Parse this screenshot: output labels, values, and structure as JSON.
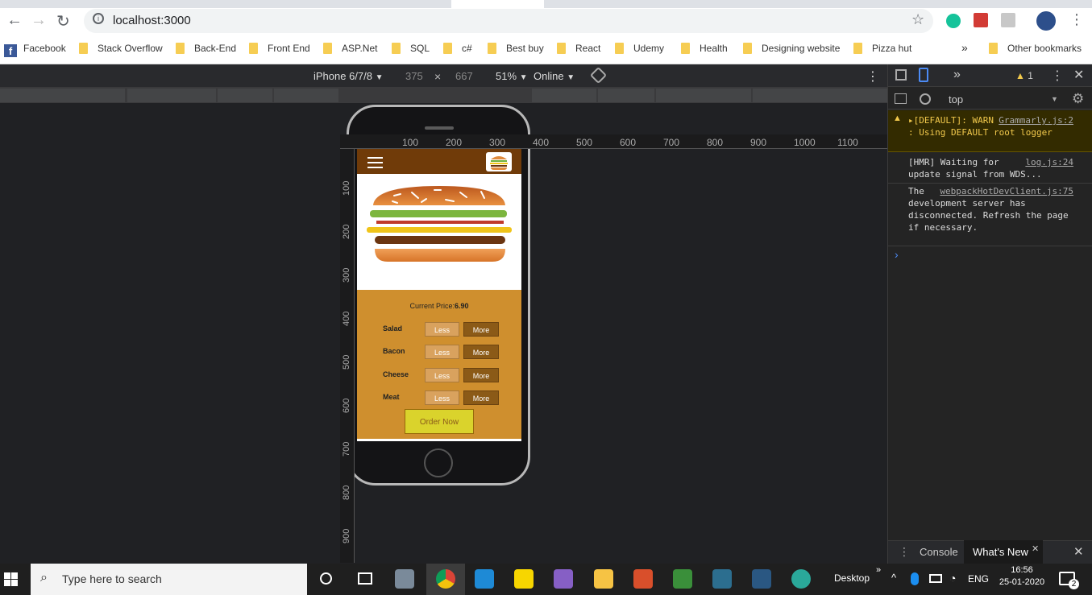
{
  "browser": {
    "url": "localhost:3000",
    "bookmarks": [
      "Facebook",
      "Stack Overflow",
      "Back-End",
      "Front End",
      "ASP.Net",
      "SQL",
      "c#",
      "Best buy",
      "React",
      "Udemy",
      "Health",
      "Designing website",
      "Pizza hut"
    ],
    "more_chevron": "»",
    "other_bookmarks": "Other bookmarks"
  },
  "device_toolbar": {
    "device": "iPhone 6/7/8",
    "width": "375",
    "times": "×",
    "height": "667",
    "zoom": "51%",
    "network": "Online"
  },
  "rulers": {
    "h": [
      "100",
      "200",
      "300",
      "400",
      "500",
      "600",
      "700",
      "800",
      "900",
      "1000",
      "1100"
    ],
    "v": [
      "100",
      "200",
      "300",
      "400",
      "500",
      "600",
      "700",
      "800",
      "900"
    ]
  },
  "app": {
    "price_label": "Current Price:",
    "price_value": "6.90",
    "controls": [
      {
        "label": "Salad",
        "less": "Less",
        "more": "More"
      },
      {
        "label": "Bacon",
        "less": "Less",
        "more": "More"
      },
      {
        "label": "Cheese",
        "less": "Less",
        "more": "More"
      },
      {
        "label": "Meat",
        "less": "Less",
        "more": "More"
      }
    ],
    "order_button": "Order Now"
  },
  "devtools": {
    "warning_count": "1",
    "context": "top",
    "messages": [
      {
        "text": "▸[DEFAULT]: WARN : Using DEFAULT root logger",
        "source": "Grammarly.js:2",
        "level": "warning"
      },
      {
        "text": "[HMR] Waiting for update signal from WDS...",
        "source": "log.js:24",
        "level": "info"
      },
      {
        "text": "The development server has disconnected. Refresh the page if necessary.",
        "source": "webpackHotDevClient.js:75",
        "level": "info"
      }
    ],
    "prompt": "›",
    "tabs": [
      "Console",
      "What's New"
    ]
  },
  "taskbar": {
    "search_placeholder": "Type here to search",
    "desktop_label": "Desktop",
    "lang": "ENG",
    "time": "16:56",
    "date": "25-01-2020",
    "notifications": "2"
  }
}
